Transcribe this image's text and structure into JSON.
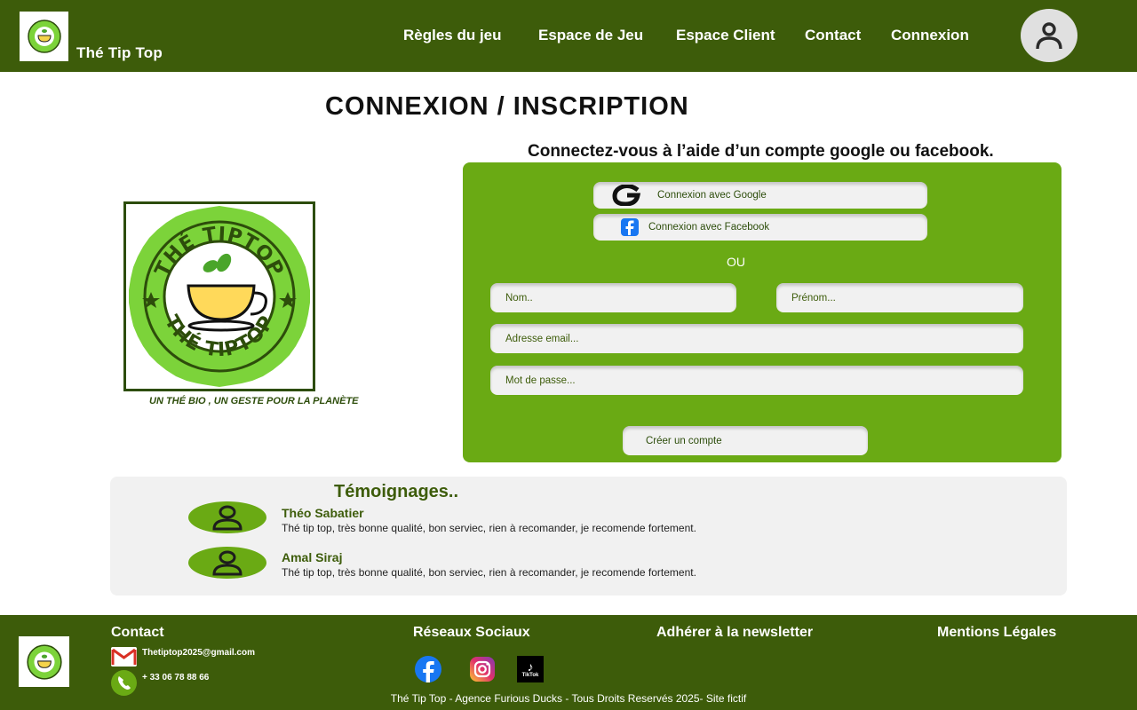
{
  "header": {
    "brand": "Thé Tip Top",
    "nav": [
      "Règles du jeu",
      "Espace de Jeu",
      "Espace Client",
      "Contact",
      "Connexion"
    ]
  },
  "main": {
    "title": "CONNEXION / INSCRIPTION",
    "subtitle": "Connectez-vous à l’aide d’un compte google ou facebook.",
    "logo": {
      "ring_text_top": "THÉ TIPTOP",
      "ring_text_bottom": "THÉ TIPTOP",
      "tagline": "UN THÉ BIO , UN GESTE POUR LA PLANÈTE"
    },
    "form": {
      "google_label": "Connexion avec Google",
      "facebook_label": "Connexion avec Facebook",
      "or_label": "OU",
      "nom_placeholder": "Nom..",
      "prenom_placeholder": "Prénom...",
      "email_placeholder": "Adresse email...",
      "password_placeholder": "Mot de passe...",
      "submit_label": "Créer un compte"
    }
  },
  "testimonials": {
    "title": "Témoignages..",
    "items": [
      {
        "name": "Théo Sabatier",
        "text": "Thé tip top, très bonne qualité, bon serviec, rien à recomander, je recomende fortement."
      },
      {
        "name": "Amal Siraj",
        "text": "Thé tip top, très bonne qualité, bon serviec, rien à recomander, je recomende fortement."
      }
    ]
  },
  "footer": {
    "contact_heading": "Contact",
    "email": "Thetiptop2025@gmail.com",
    "phone": "+ 33 06 78 88 66",
    "social_heading": "Réseaux Sociaux",
    "tiktok_label": "TikTok",
    "newsletter_heading": "Adhérer à la newsletter",
    "legal_heading": "Mentions Légales",
    "copyright": "Thé Tip Top - Agence Furious Ducks - Tous Droits Reservés 2025- Site fictif"
  },
  "colors": {
    "header_green": "#3d5c0a",
    "panel_green": "#6aaa14",
    "light_grey": "#f1f1f1"
  },
  "icons": [
    "logo-icon",
    "user-icon",
    "google-icon",
    "facebook-icon",
    "gmail-icon",
    "phone-icon",
    "instagram-icon",
    "tiktok-icon"
  ]
}
